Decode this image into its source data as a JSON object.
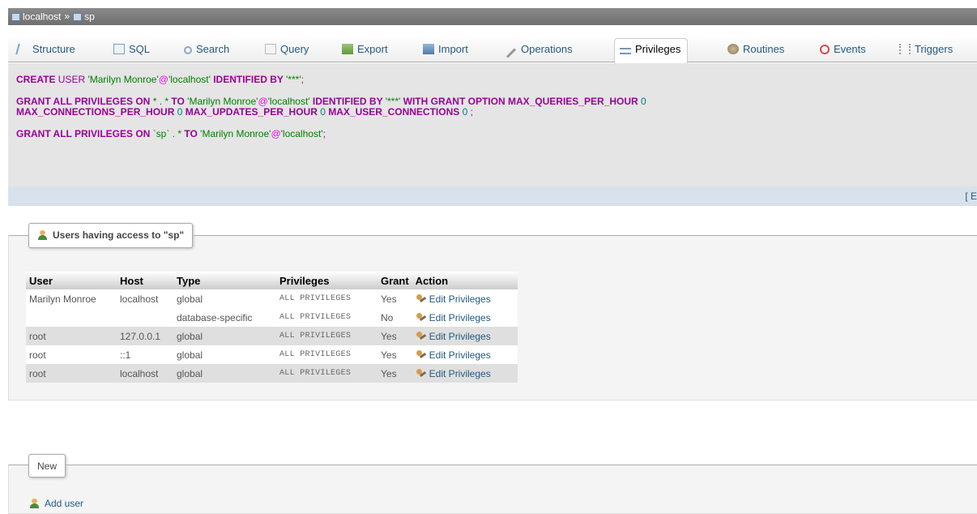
{
  "breadcrumb": {
    "server": "localhost",
    "separator": "»",
    "database": "sp"
  },
  "tabs": [
    {
      "label": "Structure",
      "icon": "structure-icon"
    },
    {
      "label": "SQL",
      "icon": "sql-icon"
    },
    {
      "label": "Search",
      "icon": "search-icon"
    },
    {
      "label": "Query",
      "icon": "query-icon"
    },
    {
      "label": "Export",
      "icon": "export-icon"
    },
    {
      "label": "Import",
      "icon": "import-icon"
    },
    {
      "label": "Operations",
      "icon": "wrench-icon"
    },
    {
      "label": "Privileges",
      "icon": "privileges-icon",
      "active": true
    },
    {
      "label": "Routines",
      "icon": "routines-icon"
    },
    {
      "label": "Events",
      "icon": "clock-icon"
    },
    {
      "label": "Triggers",
      "icon": "triggers-icon"
    }
  ],
  "sql": {
    "line1": {
      "kw1": "CREATE",
      "plain1": " USER ",
      "user": "'Marilyn Monroe'",
      "at": "@",
      "host": "'localhost'",
      "kw2": " IDENTIFIED BY ",
      "pw": "'***'",
      "end": ";"
    },
    "line2": {
      "kw1": "GRANT ALL PRIVILEGES ON ",
      "obj": "* . *",
      "kw2": " TO ",
      "user": "'Marilyn Monroe'",
      "at": "@",
      "host": "'localhost'",
      "kw3": " IDENTIFIED BY ",
      "pw": "'***'",
      "kw4": " WITH GRANT OPTION MAX_QUERIES_PER_HOUR ",
      "n1": "0",
      "kw5": "MAX_CONNECTIONS_PER_HOUR ",
      "n2": "0",
      "kw6": " MAX_UPDATES_PER_HOUR ",
      "n3": "0",
      "kw7": " MAX_USER_CONNECTIONS ",
      "n4": "0",
      "end": " ;"
    },
    "line3": {
      "kw1": "GRANT ALL PRIVILEGES ON ",
      "obj": "`sp` . *",
      "kw2": " TO ",
      "user": "'Marilyn Monroe'",
      "at": "@",
      "host": "'localhost'",
      "end": ";"
    }
  },
  "edit_link": "[ E",
  "users_group": {
    "legend": "Users having access to \"sp\"",
    "columns": [
      "User",
      "Host",
      "Type",
      "Privileges",
      "Grant",
      "Action"
    ],
    "rows": [
      {
        "user": "Marilyn Monroe",
        "host": "localhost",
        "type": "global",
        "privileges": "ALL PRIVILEGES",
        "grant": "Yes",
        "action": "Edit Privileges"
      },
      {
        "user": "",
        "host": "",
        "type": "database-specific",
        "privileges": "ALL PRIVILEGES",
        "grant": "No",
        "action": "Edit Privileges"
      },
      {
        "user": "root",
        "host": "127.0.0.1",
        "type": "global",
        "privileges": "ALL PRIVILEGES",
        "grant": "Yes",
        "action": "Edit Privileges"
      },
      {
        "user": "root",
        "host": "::1",
        "type": "global",
        "privileges": "ALL PRIVILEGES",
        "grant": "Yes",
        "action": "Edit Privileges"
      },
      {
        "user": "root",
        "host": "localhost",
        "type": "global",
        "privileges": "ALL PRIVILEGES",
        "grant": "Yes",
        "action": "Edit Privileges"
      }
    ]
  },
  "new_group": {
    "legend": "New",
    "add_user": "Add user"
  },
  "colors": {
    "keyword": "#990099",
    "string": "#008000",
    "tab_link": "#235a81",
    "breadcrumb_bg": "#7a7a7a"
  }
}
